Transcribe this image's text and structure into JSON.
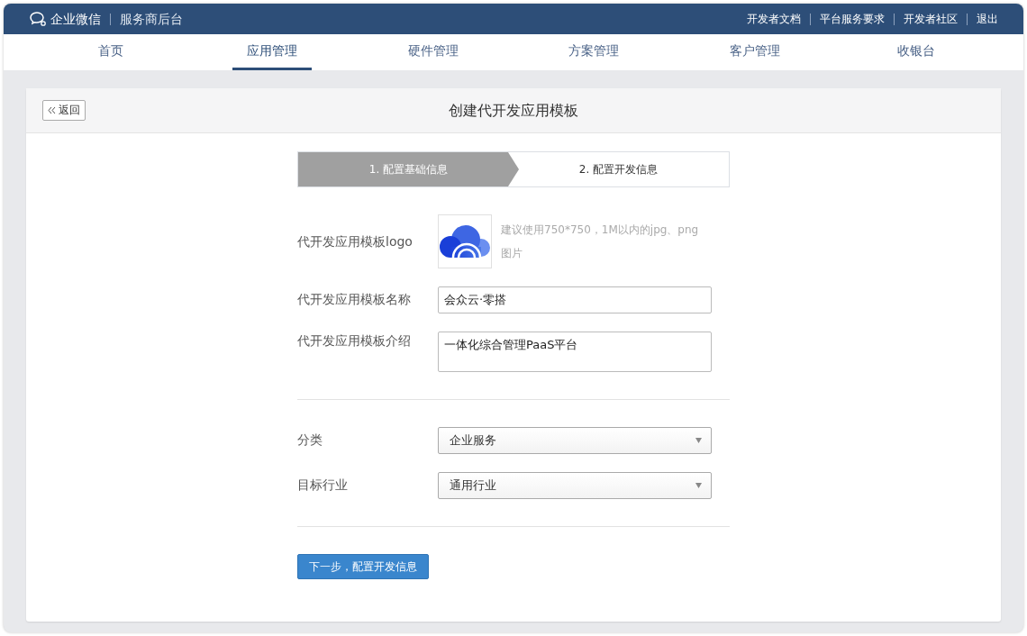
{
  "header": {
    "brand": "企业微信",
    "subtitle": "服务商后台",
    "links": [
      "开发者文档",
      "平台服务要求",
      "开发者社区",
      "退出"
    ]
  },
  "nav": [
    {
      "label": "首页",
      "selected": false
    },
    {
      "label": "应用管理",
      "selected": true
    },
    {
      "label": "硬件管理",
      "selected": false
    },
    {
      "label": "方案管理",
      "selected": false
    },
    {
      "label": "客户管理",
      "selected": false
    },
    {
      "label": "收银台",
      "selected": false
    }
  ],
  "page": {
    "back": "返回",
    "title": "创建代开发应用模板"
  },
  "steps": [
    {
      "label": "1. 配置基础信息",
      "selected": true
    },
    {
      "label": "2. 配置开发信息",
      "selected": false
    }
  ],
  "logo_field": {
    "label": "代开发应用模板logo",
    "hint": "建议使用750*750，1M以内的jpg、png图片"
  },
  "basic_fields": [
    {
      "kind": "input",
      "label": "代开发应用模板名称",
      "value": "会众云·零搭"
    },
    {
      "kind": "textarea",
      "label": "代开发应用模板介绍",
      "value": "一体化综合管理PaaS平台"
    }
  ],
  "select_fields": [
    {
      "label": "分类",
      "value": "企业服务"
    },
    {
      "label": "目标行业",
      "value": "通用行业"
    }
  ],
  "submit": "下一步，配置开发信息"
}
